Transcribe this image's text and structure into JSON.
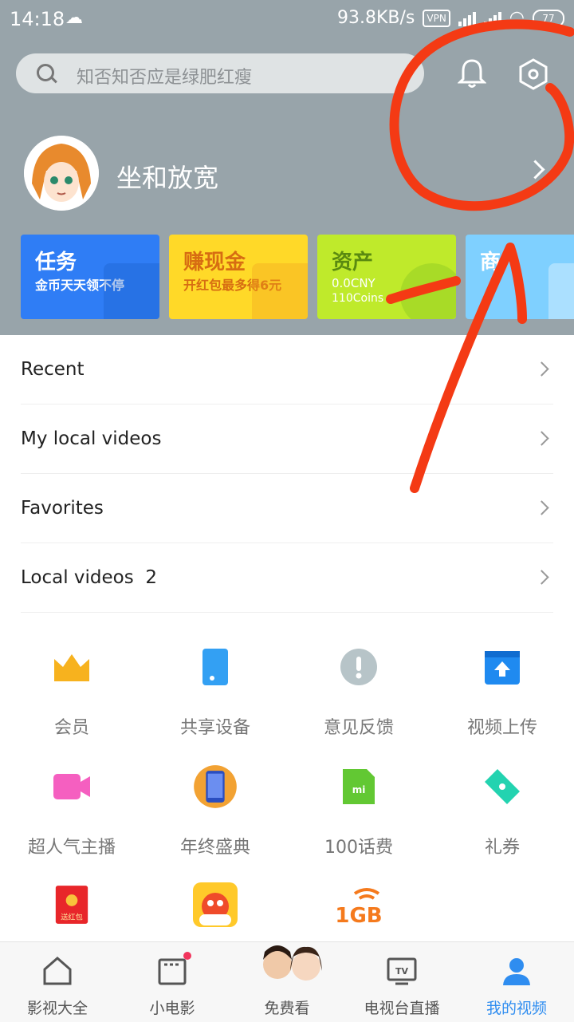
{
  "status": {
    "time": "14:18",
    "weather_icon": "cloud-sun-icon",
    "speed": "93.8KB/s",
    "vpn": "VPN",
    "battery": "77"
  },
  "search": {
    "placeholder": "知否知否应是绿肥红瘦"
  },
  "profile": {
    "name": "坐和放宽"
  },
  "cards": [
    {
      "title": "任务",
      "sub": "金币天天领不停",
      "color": "#2f7df5"
    },
    {
      "title": "赚现金",
      "sub": "开红包最多得6元",
      "color": "#ffd928"
    },
    {
      "title": "资产",
      "sub": "0.0CNY",
      "sub2": "110Coins",
      "color": "#bfea2b"
    },
    {
      "title": "商",
      "color": "#7fd0ff"
    }
  ],
  "menu": [
    {
      "label": "Recent"
    },
    {
      "label": "My local videos"
    },
    {
      "label": "Favorites"
    },
    {
      "label": "Local videos  2"
    }
  ],
  "grid": [
    {
      "label": "会员",
      "icon": "crown-icon"
    },
    {
      "label": "共享设备",
      "icon": "phone-share-icon"
    },
    {
      "label": "意见反馈",
      "icon": "feedback-icon"
    },
    {
      "label": "视频上传",
      "icon": "upload-icon"
    },
    {
      "label": "超人气主播",
      "icon": "camera-icon"
    },
    {
      "label": "年终盛典",
      "icon": "phone-gift-icon"
    },
    {
      "label": "100话费",
      "icon": "sim-card-icon"
    },
    {
      "label": "礼券",
      "icon": "ticket-icon"
    },
    {
      "label": "",
      "icon": "red-packet-icon",
      "badge": "送红包"
    },
    {
      "label": "",
      "icon": "game-icon"
    },
    {
      "label": "",
      "icon": "data-1gb-icon",
      "badge": "1GB"
    }
  ],
  "tabs": [
    {
      "label": "影视大全",
      "icon": "home-icon"
    },
    {
      "label": "小电影",
      "icon": "film-icon"
    },
    {
      "label": "免费看",
      "icon": "actors-icon"
    },
    {
      "label": "电视台直播",
      "icon": "tv-icon",
      "tv": "TV"
    },
    {
      "label": "我的视频",
      "icon": "user-icon"
    }
  ],
  "colors": {
    "accent": "#2f8df0",
    "header": "#98a4aa",
    "annotation": "#f43a14"
  }
}
